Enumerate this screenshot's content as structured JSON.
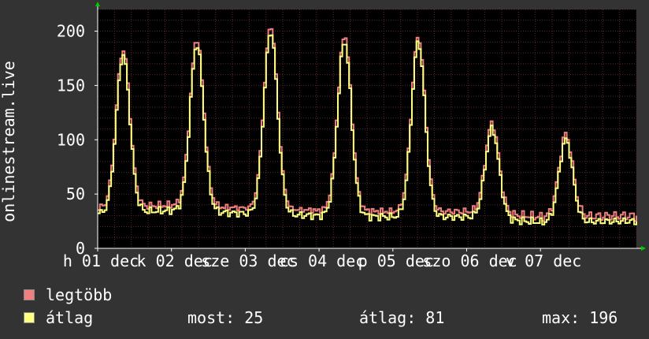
{
  "colors": {
    "background": "#333333",
    "plot_bg": "#000000",
    "grid": "#5a2a2a",
    "max_line": "#f08080",
    "avg_line": "#ffff80",
    "axis": "#ffffff",
    "arrow": "#00cc00"
  },
  "chart_data": {
    "type": "line",
    "ylabel": "onlinestream.live",
    "yticks": [
      "0",
      "50",
      "100",
      "150",
      "200"
    ],
    "ylim": [
      0,
      220
    ],
    "xticks": [
      "h 01 dec",
      "k 02 dec",
      "sze 03 dec",
      "cs 04 dec",
      "p 05 dec",
      "szo 06 dec",
      "v 07 dec"
    ],
    "grid": true,
    "series": [
      {
        "name": "legtöbb",
        "color": "#f08080",
        "key": "max"
      },
      {
        "name": "átlag",
        "color": "#ffff80",
        "key": "avg"
      }
    ],
    "days": [
      {
        "start": 32,
        "peak": 178,
        "peak_at": 0.33
      },
      {
        "start": 35,
        "peak": 188,
        "peak_at": 0.33
      },
      {
        "start": 32,
        "peak": 200,
        "peak_at": 0.33
      },
      {
        "start": 30,
        "peak": 191,
        "peak_at": 0.33
      },
      {
        "start": 29,
        "peak": 190,
        "peak_at": 0.33
      },
      {
        "start": 29,
        "peak": 110,
        "peak_at": 0.33
      },
      {
        "start": 24,
        "peak": 100,
        "peak_at": 0.33
      }
    ],
    "end_value": 25
  },
  "legend": {
    "max_label": "legtöbb",
    "avg_label": "átlag",
    "now_text": "most: 25",
    "avg_text": "átlag: 81",
    "max_text": "max: 196"
  }
}
